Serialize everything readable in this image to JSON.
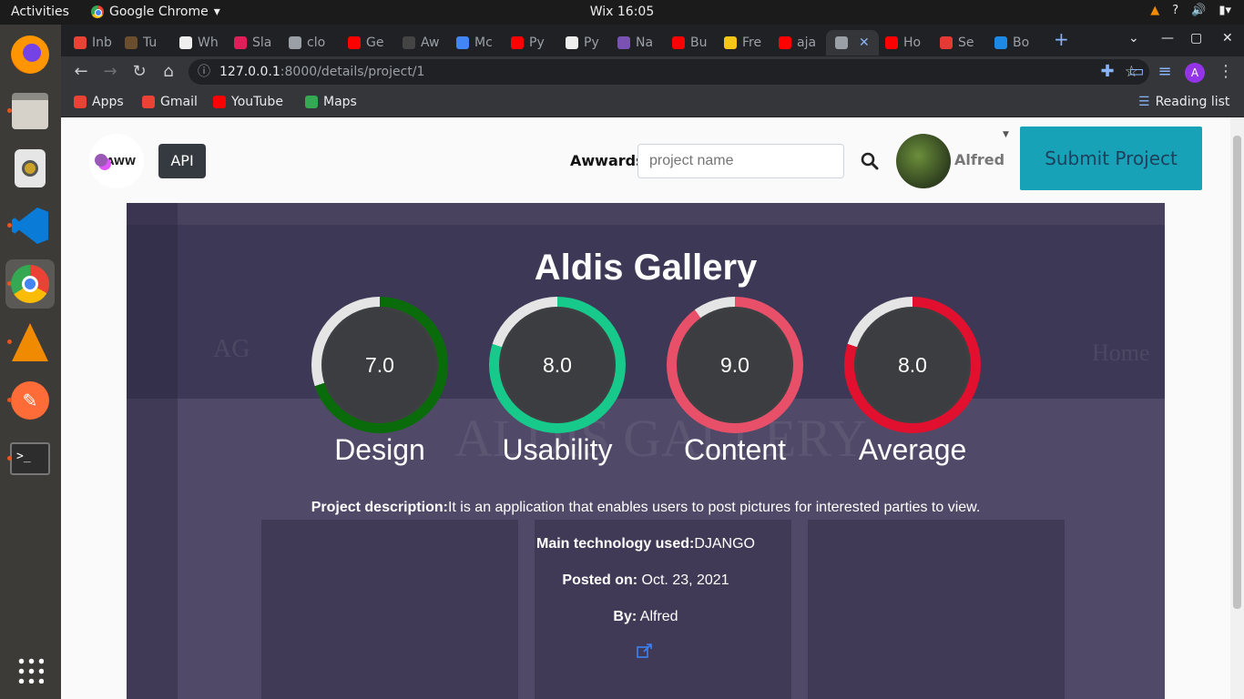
{
  "os": {
    "activities": "Activities",
    "app_name": "Google Chrome",
    "clock": "Wix 16:05"
  },
  "browser": {
    "tabs": [
      {
        "label": "Inb",
        "color": "#ea4335"
      },
      {
        "label": "Tu",
        "color": "#6b4e2e"
      },
      {
        "label": "Wh",
        "color": "#eeeeee"
      },
      {
        "label": "Sla",
        "color": "#e01e5a"
      },
      {
        "label": "clo",
        "color": "#9aa0a6"
      },
      {
        "label": "Ge",
        "color": "#ff0000"
      },
      {
        "label": "Aw",
        "color": "#444444"
      },
      {
        "label": "Mc",
        "color": "#4285f4"
      },
      {
        "label": "Py",
        "color": "#ff0000"
      },
      {
        "label": "Py",
        "color": "#eeeeee"
      },
      {
        "label": "Na",
        "color": "#7952b3"
      },
      {
        "label": "Bu",
        "color": "#ff0000"
      },
      {
        "label": "Fre",
        "color": "#f5c518"
      },
      {
        "label": "aja",
        "color": "#ff0000"
      },
      {
        "label": "",
        "color": "#9aa0a6"
      },
      {
        "label": "Ho",
        "color": "#ff0000"
      },
      {
        "label": "Se",
        "color": "#e53935"
      },
      {
        "label": "Bo",
        "color": "#1e88e5"
      }
    ],
    "url_host": "127.0.0.1",
    "url_path": ":8000/details/project/1",
    "bookmarks": [
      {
        "label": "Apps",
        "color": "#ea4335"
      },
      {
        "label": "Gmail",
        "color": "#ea4335"
      },
      {
        "label": "YouTube",
        "color": "#ff0000"
      },
      {
        "label": "Maps",
        "color": "#34a853"
      }
    ],
    "reading_list": "Reading list",
    "profile_initial": "A"
  },
  "site": {
    "logo_text": "AWW",
    "api_label": "API",
    "awwards_label": "Awwards.",
    "search_placeholder": "project name",
    "username": "Alfred",
    "submit_label": "Submit Project"
  },
  "project": {
    "title": "Aldis Gallery",
    "ratings": [
      {
        "label": "Design",
        "value": "7.0",
        "score": 7.0,
        "color": "#0a6b0a"
      },
      {
        "label": "Usability",
        "value": "8.0",
        "score": 8.0,
        "color": "#17c98a"
      },
      {
        "label": "Content",
        "value": "9.0",
        "score": 9.0,
        "color": "#e8506a"
      },
      {
        "label": "Average",
        "value": "8.0",
        "score": 8.0,
        "color": "#e0102e"
      }
    ],
    "description_label": "Project description:",
    "description": "It is an application that enables users to post pictures for interested parties to view.",
    "tech_label": "Main technology used:",
    "tech": "DJANGO",
    "posted_label": "Posted on:",
    "posted": "Oct. 23, 2021",
    "by_label": "By:",
    "by": "Alfred"
  }
}
